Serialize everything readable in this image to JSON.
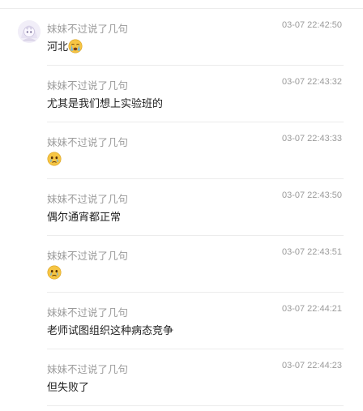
{
  "messages": [
    {
      "username": "妹妹不过说了几句",
      "time": "03-07 22:42:50",
      "text": "河北",
      "emoji": "crying-face-emoji",
      "avatar": "avatar-image"
    },
    {
      "username": "妹妹不过说了几句",
      "time": "03-07 22:43:32",
      "text": "尤其是我们想上实验班的"
    },
    {
      "username": "妹妹不过说了几句",
      "time": "03-07 22:43:33",
      "text": "",
      "emoji": "teary-face-emoji"
    },
    {
      "username": "妹妹不过说了几句",
      "time": "03-07 22:43:50",
      "text": "偶尔通宵都正常"
    },
    {
      "username": "妹妹不过说了几句",
      "time": "03-07 22:43:51",
      "text": "",
      "emoji": "teary-face-emoji"
    },
    {
      "username": "妹妹不过说了几句",
      "time": "03-07 22:44:21",
      "text": "老师试图组织这种病态竞争"
    },
    {
      "username": "妹妹不过说了几句",
      "time": "03-07 22:44:23",
      "text": "但失败了"
    }
  ]
}
